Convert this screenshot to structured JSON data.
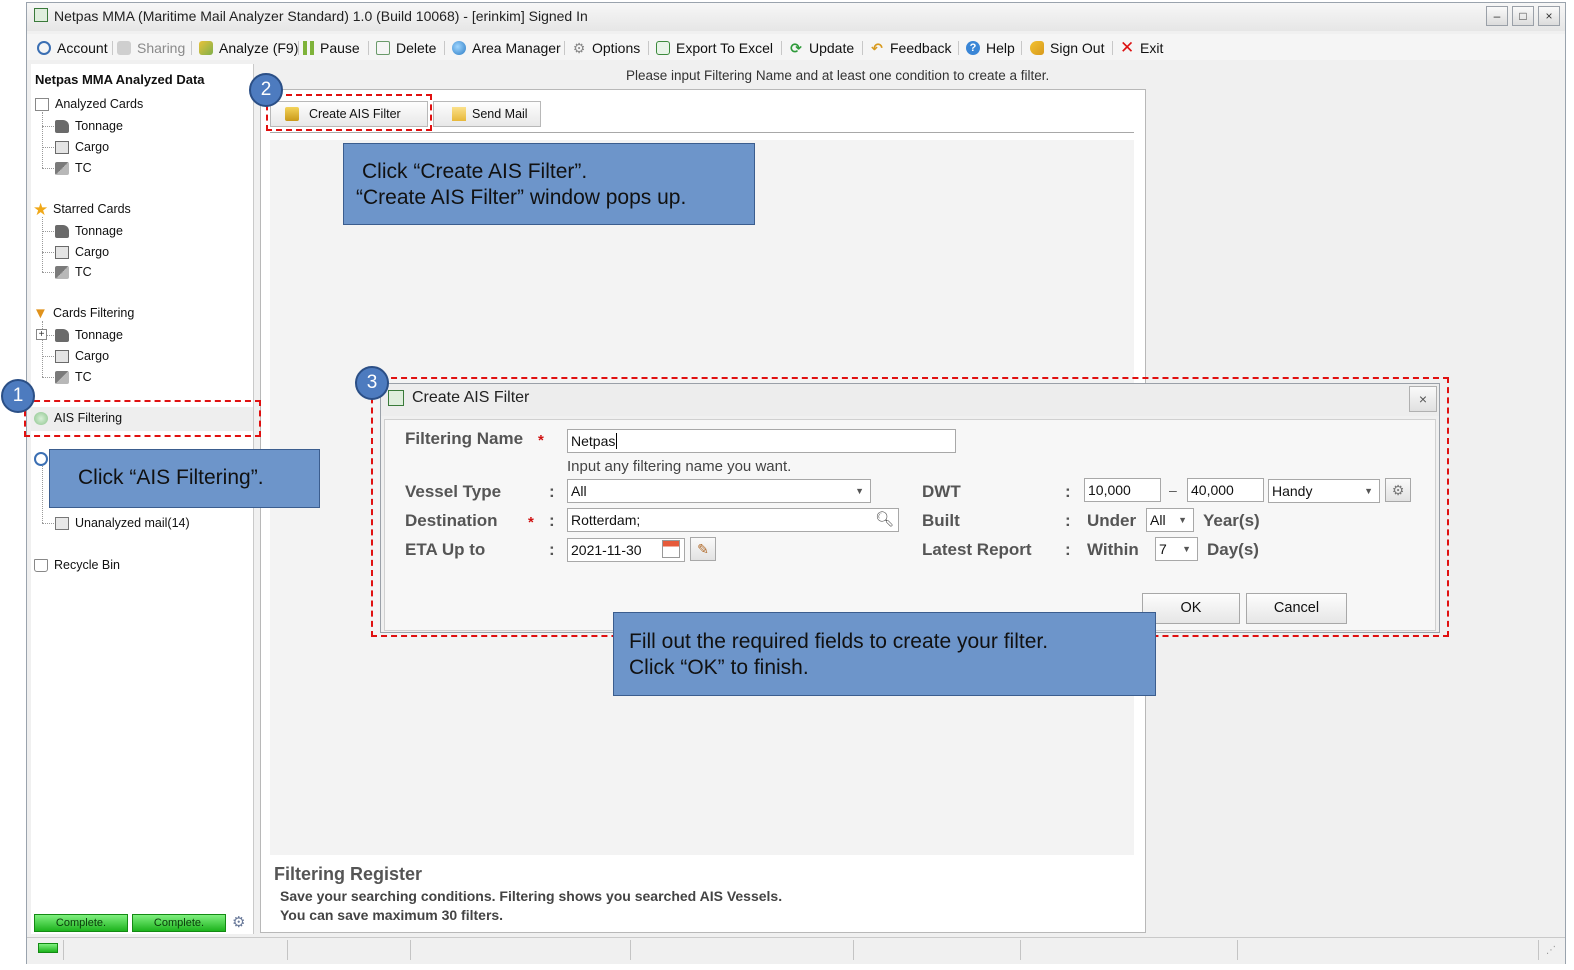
{
  "window": {
    "title": "Netpas MMA (Maritime Mail Analyzer Standard) 1.0 (Build 10068) - [erinkim] Signed In",
    "controls": [
      "–",
      "□",
      "×"
    ]
  },
  "menu": [
    {
      "label": "Account",
      "icon": "at-icon"
    },
    {
      "label": "Sharing",
      "icon": "share-icon",
      "disabled": true
    },
    {
      "label": "Analyze (F9)",
      "icon": "analyze-icon"
    },
    {
      "label": "Pause",
      "icon": "pause-icon"
    },
    {
      "label": "Delete",
      "icon": "trash-icon"
    },
    {
      "label": "Area Manager",
      "icon": "globe-icon"
    },
    {
      "label": "Options",
      "icon": "gear-icon"
    },
    {
      "label": "Export To Excel",
      "icon": "excel-icon"
    },
    {
      "label": "Update",
      "icon": "refresh-icon"
    },
    {
      "label": "Feedback",
      "icon": "feedback-arrow-icon"
    },
    {
      "label": "Help",
      "icon": "help-icon"
    },
    {
      "label": "Sign Out",
      "icon": "key-icon"
    },
    {
      "label": "Exit",
      "icon": "exit-x-icon"
    }
  ],
  "sidebar": {
    "header": "Netpas MMA Analyzed Data",
    "groups": [
      {
        "label": "Analyzed Cards",
        "children": [
          "Tonnage",
          "Cargo",
          "TC"
        ]
      },
      {
        "label": "Starred Cards",
        "children": [
          "Tonnage",
          "Cargo",
          "TC"
        ]
      },
      {
        "label": "Cards Filtering",
        "children": [
          "Tonnage",
          "Cargo",
          "TC"
        ]
      }
    ],
    "ais_filtering": "AIS Filtering",
    "unanalyzed_mail": "Unanalyzed mail(14)",
    "recycle_bin": "Recycle Bin",
    "progress": [
      "Complete.",
      "Complete."
    ]
  },
  "main": {
    "hint": "Please input Filtering Name and at least one condition to create a filter.",
    "toolbar": {
      "create_ais_filter": "Create AIS Filter",
      "send_mail": "Send Mail"
    },
    "register": {
      "title": "Filtering Register",
      "line1": "Save your searching conditions. Filtering shows you searched AIS Vessels.",
      "line2": "You can save maximum 30 filters."
    }
  },
  "dialog": {
    "title": "Create AIS Filter",
    "close": "×",
    "filtering_name": {
      "label": "Filtering Name",
      "required": "*",
      "value": "Netpas",
      "hint": "Input any filtering name you want."
    },
    "vessel_type": {
      "label": "Vessel Type",
      "colon": ":",
      "value": "All"
    },
    "destination": {
      "label": "Destination",
      "required": "*",
      "colon": ":",
      "value": "Rotterdam;"
    },
    "eta": {
      "label": "ETA Up to",
      "colon": ":",
      "value": "2021-11-30"
    },
    "dwt": {
      "label": "DWT",
      "colon": ":",
      "from": "10,000",
      "dash": "–",
      "to": "40,000",
      "class": "Handy"
    },
    "built": {
      "label": "Built",
      "colon": ":",
      "prefix": "Under",
      "value": "All",
      "suffix": "Year(s)"
    },
    "latest_report": {
      "label": "Latest Report",
      "colon": ":",
      "prefix": "Within",
      "value": "7",
      "suffix": "Day(s)"
    },
    "ok": "OK",
    "cancel": "Cancel"
  },
  "annotations": {
    "step1": "1",
    "step2": "2",
    "step3": "3",
    "callout1": "Click “AIS Filtering”.",
    "callout2_line1": "Click “Create AIS Filter”.",
    "callout2_line2": "“Create AIS Filter” window pops up.",
    "callout3_line1": "Fill out the required fields to create your filter.",
    "callout3_line2": "Click “OK” to finish."
  },
  "colors": {
    "accent_blue": "#6d95ca",
    "annotation_red": "#e01010",
    "progress_green": "#1db31d"
  }
}
